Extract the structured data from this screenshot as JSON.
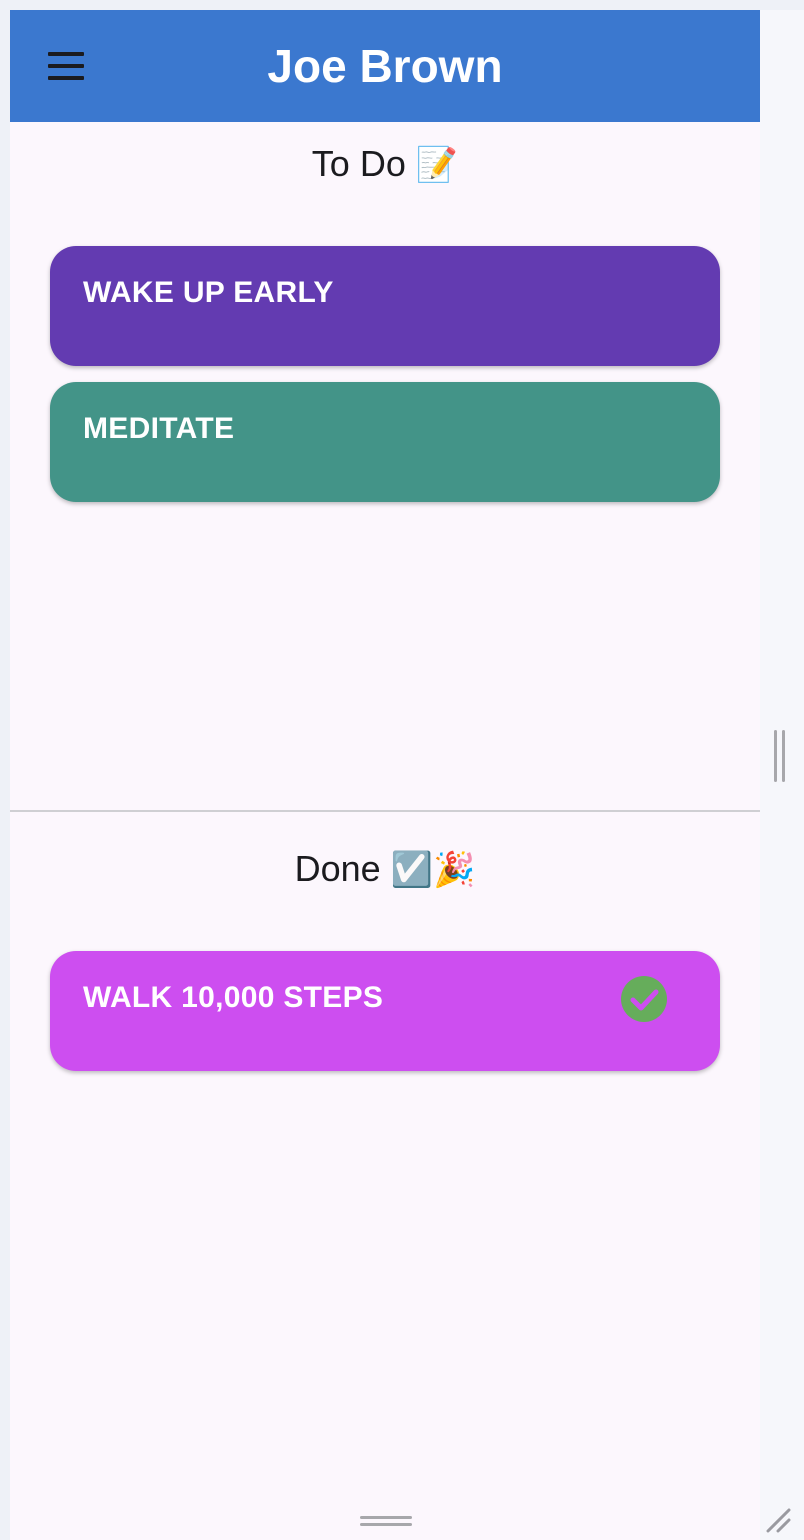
{
  "app": {
    "title": "Joe Brown",
    "menu_icon": "hamburger-menu-icon",
    "appbar_color": "#3b78cf"
  },
  "todo": {
    "title": "To Do",
    "title_emoji": "📝",
    "items": [
      {
        "label": "WAKE UP EARLY",
        "color": "#633bb1",
        "done": false
      },
      {
        "label": "MEDITATE",
        "color": "#439488",
        "done": false
      }
    ]
  },
  "done": {
    "title": "Done",
    "title_emoji": "☑️🎉",
    "items": [
      {
        "label": "WALK 10,000 STEPS",
        "color": "#cd4ef0",
        "done": true,
        "status_icon": "check-circle-icon",
        "status_color": "#66ad5b"
      }
    ]
  }
}
